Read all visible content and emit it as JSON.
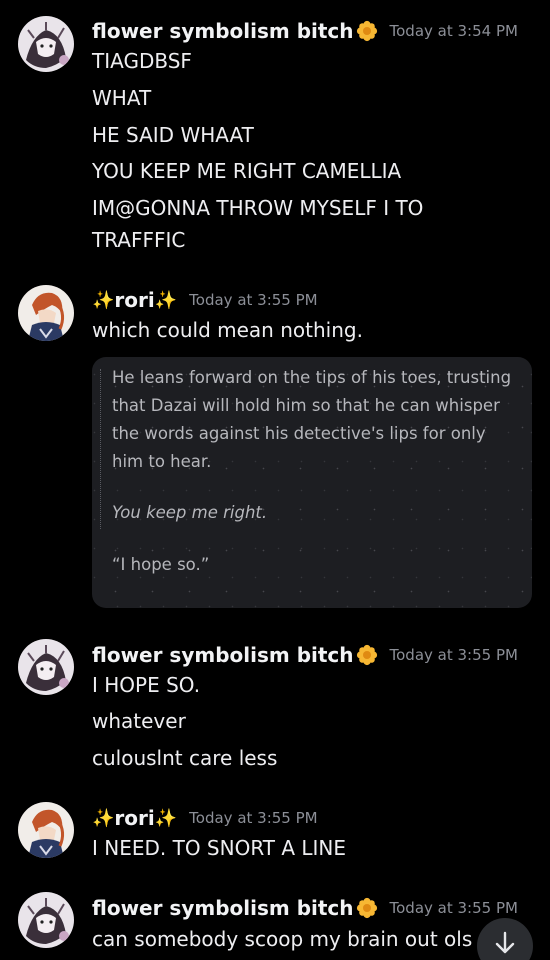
{
  "messages": [
    {
      "author": "flower symbolism bitch",
      "timestamp": "Today at 3:54 PM",
      "lines": [
        "TIAGDBSF",
        "WHAT",
        "HE SAID WHAAT",
        "YOU KEEP ME RIGHT CAMELLIA",
        "IM@GONNA THROW MYSELF I TO",
        "TRAFFFIC"
      ]
    },
    {
      "author": "rori",
      "timestamp": "Today at 3:55 PM",
      "lines": [
        "which could mean nothing."
      ],
      "embed": {
        "lines": [
          "He leans forward on the tips of his toes, trusting",
          "that Dazai will hold him so that he can whisper",
          "the words against his detective's lips for only",
          "him to hear.",
          "You keep me right.",
          "“I hope so.”"
        ]
      }
    },
    {
      "author": "flower symbolism bitch",
      "timestamp": "Today at 3:55 PM",
      "lines": [
        "I HOPE SO.",
        "whatever",
        "culouslnt care less"
      ]
    },
    {
      "author": "rori",
      "timestamp": "Today at 3:55 PM",
      "lines": [
        "I NEED. TO SNORT A LINE"
      ]
    },
    {
      "author": "flower symbolism bitch",
      "timestamp": "Today at 3:55 PM",
      "lines": [
        "can somebody scoop my brain out ols"
      ]
    }
  ],
  "icons": {
    "author_badge": "flower-badge-icon",
    "sparkle": "sparkle-icon",
    "scroll_button": "arrow-down-icon"
  },
  "colors": {
    "background": "#000000",
    "embed_background": "#1d1e22",
    "timestamp": "#8c8f97",
    "badge": "#f7c948"
  }
}
